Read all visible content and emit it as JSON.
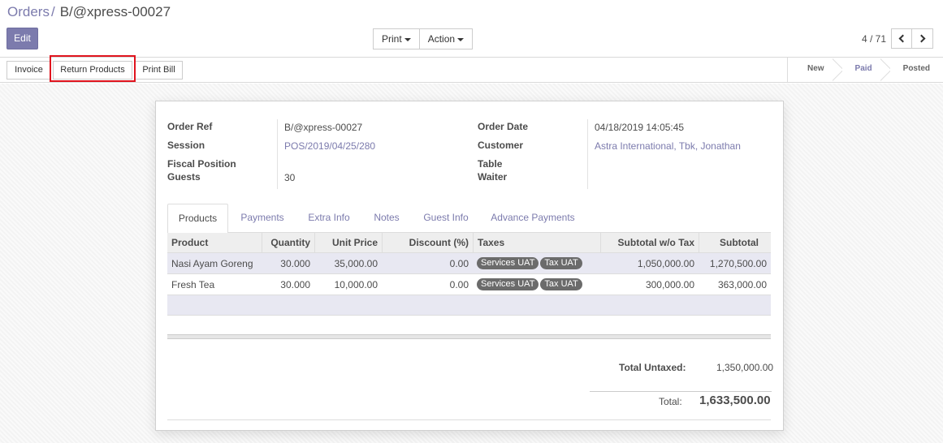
{
  "breadcrumb": {
    "parent": "Orders",
    "separator": "/",
    "current": "B/@xpress-00027"
  },
  "toolbar": {
    "edit_label": "Edit",
    "print_label": "Print",
    "action_label": "Action"
  },
  "pager": {
    "value": "4 / 71"
  },
  "statusbar": {
    "buttons": [
      "Invoice",
      "Return Products",
      "Print Bill"
    ],
    "stages": [
      "New",
      "Paid",
      "Posted"
    ],
    "current_stage": "Paid"
  },
  "order": {
    "labels": {
      "order_ref": "Order Ref",
      "session": "Session",
      "fiscal_position": "Fiscal Position",
      "guests": "Guests",
      "order_date": "Order Date",
      "customer": "Customer",
      "table": "Table",
      "waiter": "Waiter"
    },
    "order_ref": "B/@xpress-00027",
    "session": "POS/2019/04/25/280",
    "guests": "30",
    "order_date": "04/18/2019 14:05:45",
    "customer": "Astra International, Tbk, Jonathan"
  },
  "tabs": [
    "Products",
    "Payments",
    "Extra Info",
    "Notes",
    "Guest Info",
    "Advance Payments"
  ],
  "table": {
    "columns": [
      "Product",
      "Quantity",
      "Unit Price",
      "Discount (%)",
      "Taxes",
      "Subtotal w/o Tax",
      "Subtotal"
    ],
    "rows": [
      {
        "product": "Nasi Ayam Goreng",
        "quantity": "30.000",
        "unit_price": "35,000.00",
        "discount": "0.00",
        "taxes": [
          "Services UAT",
          "Tax UAT"
        ],
        "subtotal_wo_tax": "1,050,000.00",
        "subtotal": "1,270,500.00"
      },
      {
        "product": "Fresh Tea",
        "quantity": "30.000",
        "unit_price": "10,000.00",
        "discount": "0.00",
        "taxes": [
          "Services UAT",
          "Tax UAT"
        ],
        "subtotal_wo_tax": "300,000.00",
        "subtotal": "363,000.00"
      }
    ]
  },
  "totals": {
    "untaxed_label": "Total Untaxed:",
    "untaxed_value": "1,350,000.00",
    "total_label": "Total:",
    "total_value": "1,633,500.00"
  },
  "colors": {
    "accent": "#7c7bad",
    "highlight": "#e0141e",
    "tag": "#6b6b6b"
  },
  "icons": {
    "pager_prev": "chevron-left-icon",
    "pager_next": "chevron-right-icon",
    "dropdown": "caret-down-icon"
  }
}
